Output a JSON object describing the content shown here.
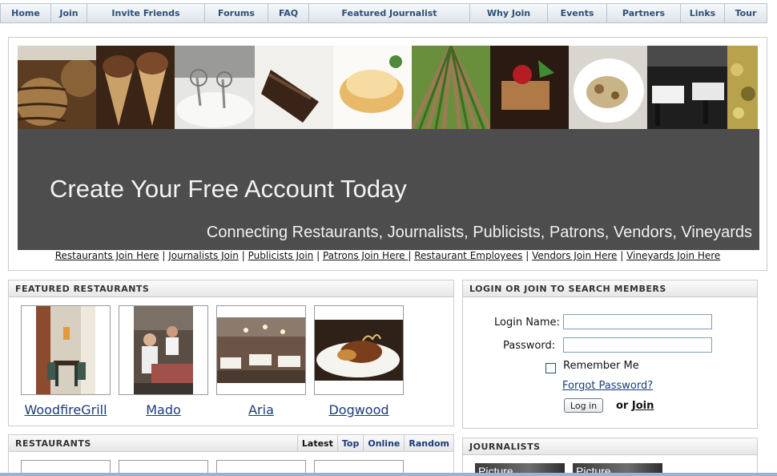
{
  "nav": {
    "items": [
      "Home",
      "Join",
      "Invite Friends",
      "Forums",
      "FAQ",
      "Featured Journalist",
      "Why Join",
      "Events",
      "Partners",
      "Links",
      "Tour"
    ]
  },
  "banner": {
    "headline": "Create Your Free Account Today",
    "subline": "Connecting Restaurants, Journalists, Publicists, Patrons, Vendors, Vineyards"
  },
  "join_links": [
    "Restaurants Join Here",
    "Journalists Join",
    "Publicists Join",
    "Patrons Join Here ",
    "Restaurant Employees",
    "Vendors Join Here",
    "Vineyards Join Here"
  ],
  "featured": {
    "title": "FEATURED RESTAURANTS",
    "items": [
      "WoodfireGrill",
      "Mado",
      "Aria",
      "Dogwood"
    ]
  },
  "restaurants": {
    "title": "RESTAURANTS",
    "tabs": [
      "Latest",
      "Top",
      "Online",
      "Random"
    ]
  },
  "login": {
    "title": "LOGIN OR JOIN TO SEARCH MEMBERS",
    "login_name_label": "Login Name:",
    "password_label": "Password:",
    "remember_label": "Remember Me",
    "forgot_label": "Forgot Password?",
    "login_button": "Log in",
    "or_text": "or",
    "join_link": "Join"
  },
  "journalists": {
    "title": "JOURNALISTS",
    "pictures": [
      "Picture",
      "Picture"
    ]
  },
  "colors": {
    "nav_text": "#2c4f7a",
    "link_blue": "#1a3b77",
    "banner_panel": "#4d4d4d"
  }
}
